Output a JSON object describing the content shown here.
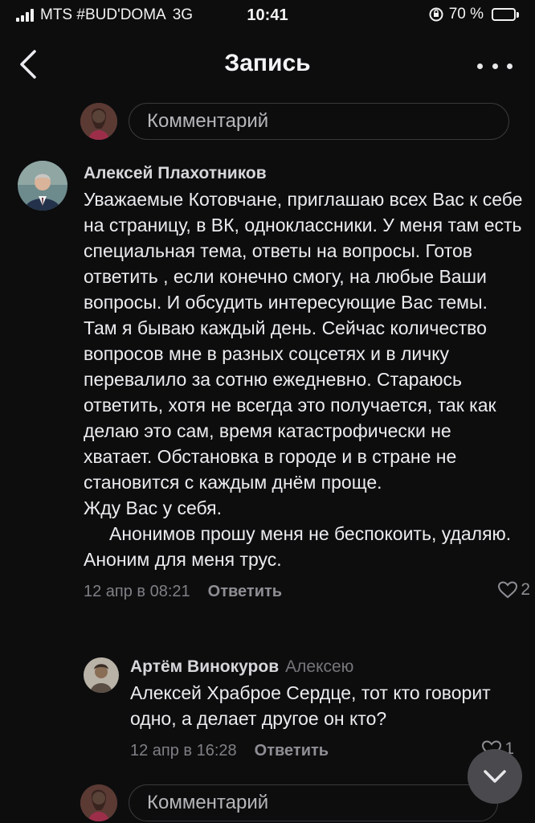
{
  "status_bar": {
    "carrier": "MTS #BUD'DOMA",
    "network": "3G",
    "time": "10:41",
    "battery": "70 %",
    "battery_level": 0.7
  },
  "header": {
    "title": "Запись"
  },
  "comment_input": {
    "placeholder": "Комментарий"
  },
  "comment": {
    "author": "Алексей Плахотников",
    "text_lines": [
      "Уважаемые Котовчане, приглашаю всех Вас к себе на страницу, в ВК, одноклассники. У меня там есть специальная тема, ответы на вопросы. Готов ответить , если конечно смогу, на любые Ваши вопросы. И обсудить интересующие Вас темы. Там я бываю каждый день. Сейчас количество вопросов мне в разных соцсетях и в личку перевалило за сотню ежедневно. Стараюсь ответить, хотя не всегда это получается, так как делаю это сам, время катастрофически не хватает. Обстановка в городе и в стране не становится с каждым днём проще.",
      "Жду Вас у себя.",
      "Анонимов прошу меня не беспокоить, удаляю. Аноним для меня трус."
    ],
    "date": "12 апр в 08:21",
    "reply_label": "Ответить",
    "likes": "2"
  },
  "reply": {
    "author": "Артём Винокуров",
    "to": "Алексею",
    "text": "Алексей Храброе Сердце, тот кто говорит одно, а делает другое он кто?",
    "date": "12 апр в 16:28",
    "reply_label": "Ответить",
    "likes": "1"
  },
  "icons": {
    "back": "chevron-left-icon",
    "more": "more-horizontal-icon",
    "like": "heart-outline-icon",
    "scroll_down": "chevron-down-icon"
  }
}
